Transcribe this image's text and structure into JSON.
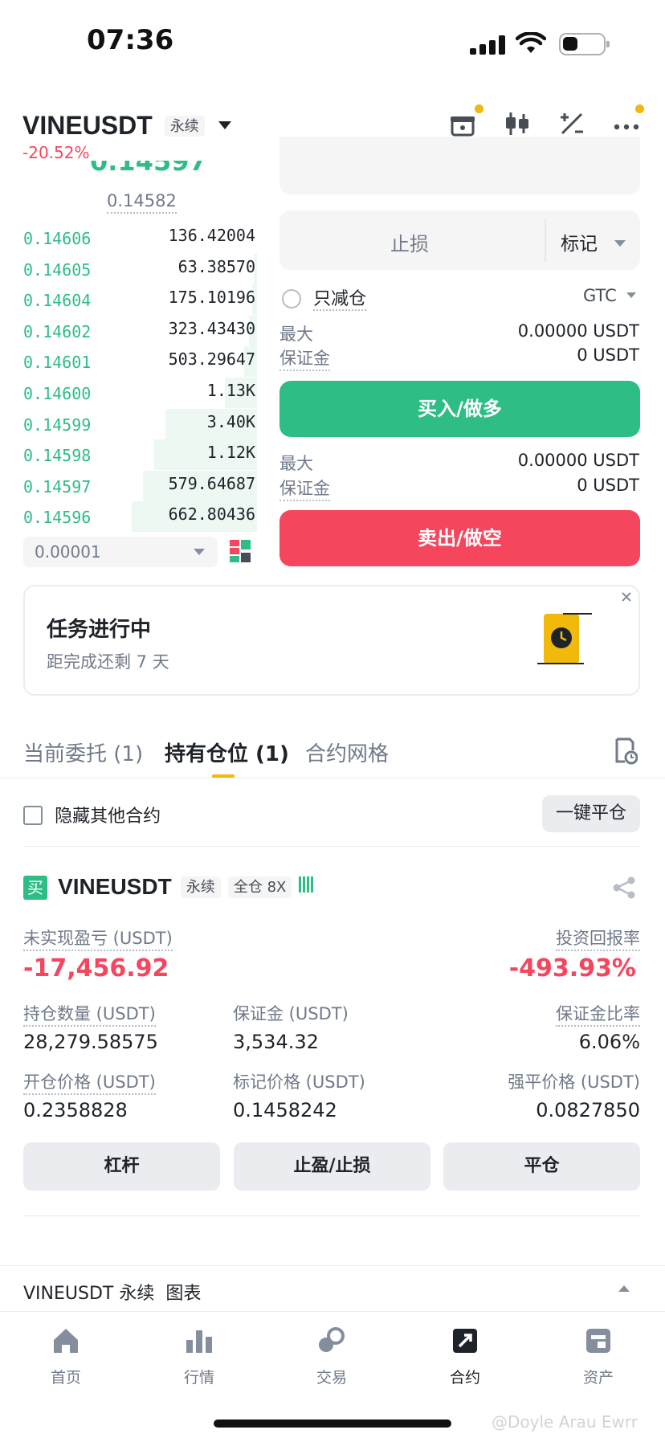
{
  "status_bar": {
    "time": "07:36",
    "battery_level": 0.35
  },
  "header": {
    "symbol": "VINEUSDT",
    "contract_type": "永续",
    "change": "-20.52%"
  },
  "order_book": {
    "top_price_partial": "0.14597",
    "mark_price": "0.14582",
    "rows": [
      {
        "price": "0.14606",
        "qty": "136.42004",
        "depth": 0.0
      },
      {
        "price": "0.14605",
        "qty": "63.38570",
        "depth": 0.02
      },
      {
        "price": "0.14604",
        "qty": "175.10196",
        "depth": 0.03
      },
      {
        "price": "0.14602",
        "qty": "323.43430",
        "depth": 0.05
      },
      {
        "price": "0.14601",
        "qty": "503.29647",
        "depth": 0.08
      },
      {
        "price": "0.14600",
        "qty": "1.13K",
        "depth": 0.2
      },
      {
        "price": "0.14599",
        "qty": "3.40K",
        "depth": 0.57
      },
      {
        "price": "0.14598",
        "qty": "1.12K",
        "depth": 0.64
      },
      {
        "price": "0.14597",
        "qty": "579.64687",
        "depth": 0.71
      },
      {
        "price": "0.14596",
        "qty": "662.80436",
        "depth": 0.78
      }
    ],
    "precision": "0.00001"
  },
  "order_form": {
    "stop_loss_placeholder": "止损",
    "trigger_type": "标记",
    "reduce_only_label": "只减仓",
    "time_in_force": "GTC",
    "buy": {
      "max_label": "最大",
      "max_value": "0.00000 USDT",
      "margin_label": "保证金",
      "margin_value": "0 USDT",
      "button": "买入/做多"
    },
    "sell": {
      "max_label": "最大",
      "max_value": "0.00000 USDT",
      "margin_label": "保证金",
      "margin_value": "0 USDT",
      "button": "卖出/做空"
    }
  },
  "task_card": {
    "title": "任务进行中",
    "subtitle": "距完成还剩 7 天"
  },
  "tabs": [
    {
      "label": "当前委托 (1)"
    },
    {
      "label": "持有仓位 (1)"
    },
    {
      "label": "合约网格"
    }
  ],
  "positions_toolbar": {
    "hide_other": "隐藏其他合约",
    "close_all": "一键平仓"
  },
  "position": {
    "side": "买",
    "symbol": "VINEUSDT",
    "contract_type": "永续",
    "margin_mode": "全仓 8X",
    "unrealized_pnl_label": "未实现盈亏 (USDT)",
    "unrealized_pnl": "-17,456.92",
    "roi_label": "投资回报率",
    "roi": "-493.93%",
    "size_label": "持仓数量 (USDT)",
    "size": "28,279.58575",
    "margin_label": "保证金 (USDT)",
    "margin": "3,534.32",
    "margin_ratio_label": "保证金比率",
    "margin_ratio": "6.06%",
    "entry_label": "开仓价格 (USDT)",
    "entry_price": "0.2358828",
    "mark_label": "标记价格 (USDT)",
    "mark_price": "0.1458242",
    "liq_label": "强平价格 (USDT)",
    "liq_price": "0.0827850",
    "actions": {
      "leverage": "杠杆",
      "tpsl": "止盈/止损",
      "close": "平仓"
    }
  },
  "chart_bar": {
    "label": "VINEUSDT 永续  图表"
  },
  "bottom_nav": [
    {
      "label": "首页",
      "icon": "home-icon"
    },
    {
      "label": "行情",
      "icon": "markets-icon"
    },
    {
      "label": "交易",
      "icon": "trade-icon"
    },
    {
      "label": "合约",
      "icon": "futures-icon"
    },
    {
      "label": "资产",
      "icon": "wallet-icon"
    }
  ],
  "watermark": "@Doyle Arau Ewrr",
  "colors": {
    "green": "#2ebd85",
    "red": "#f6465d",
    "yellow": "#f0b90b"
  }
}
